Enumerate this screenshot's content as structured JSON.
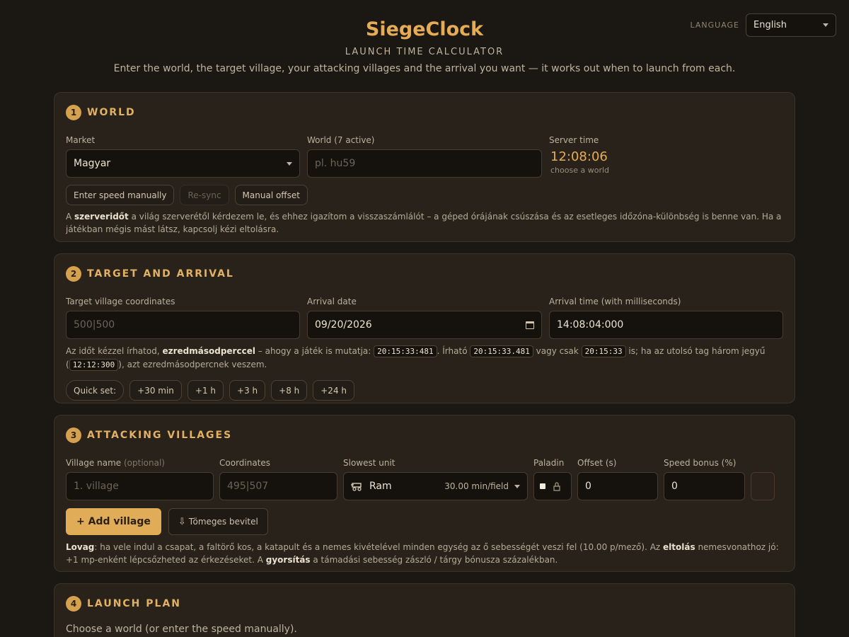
{
  "language": {
    "label": "LANGUAGE",
    "value": "English"
  },
  "header": {
    "title": "SiegeClock",
    "subtitle": "LAUNCH TIME CALCULATOR",
    "intro": "Enter the world, the target village, your attacking villages and the arrival you want — it works out when to launch from each."
  },
  "world": {
    "num": "1",
    "title": "WORLD",
    "market_label": "Market",
    "market_value": "Magyar",
    "world_label": "World (7 active)",
    "world_placeholder": "pl. hu59",
    "server_label": "Server time",
    "server_time": "12:08:06",
    "server_note": "choose a world",
    "btn_speed": "Enter speed manually",
    "btn_resync": "Re-sync",
    "btn_offset": "Manual offset",
    "note_pre": "A ",
    "note_bold": "szerveridőt",
    "note_post": " a világ szerverétől kérdezem le, és ehhez igazítom a visszaszámlálót – a géped órájának csúszása és az esetleges időzóna-különbség is benne van. Ha a játékban mégis mást látsz, kapcsolj kézi eltolásra."
  },
  "target": {
    "num": "2",
    "title": "TARGET AND ARRIVAL",
    "coords_label": "Target village coordinates",
    "coords_placeholder": "500|500",
    "date_label": "Arrival date",
    "date_value": "09/20/2026",
    "time_label": "Arrival time (with milliseconds)",
    "time_value": "14:08:04:000",
    "note_1": "Az időt kézzel írhatod, ",
    "note_bold": "ezredmásodperccel",
    "note_2": " – ahogy a játék is mutatja: ",
    "ex_1": "20:15:33:481",
    "note_3": ". Írható ",
    "ex_2": "20:15:33.481",
    "note_4": " vagy csak ",
    "ex_3": "20:15:33",
    "note_5": " is; ha az utolsó tag három jegyű (",
    "ex_4": "12:12:300",
    "note_6": "), azt ezredmásodpercnek veszem.",
    "quick_label": "Quick set:",
    "quick": [
      "+30 min",
      "+1 h",
      "+3 h",
      "+8 h",
      "+24 h"
    ]
  },
  "attack": {
    "num": "3",
    "title": "ATTACKING VILLAGES",
    "name_label": "Village name",
    "name_optional": "(optional)",
    "name_placeholder": "1. village",
    "coords_label": "Coordinates",
    "coords_placeholder": "495|507",
    "unit_label": "Slowest unit",
    "unit_value": "Ram",
    "unit_speed": "30.00 min/field",
    "paladin_label": "Paladin",
    "offset_label": "Offset (s)",
    "offset_value": "0",
    "bonus_label": "Speed bonus (%)",
    "bonus_value": "0",
    "add_btn": "+ Add village",
    "bulk_btn": "Tömeges bevitel",
    "note_b1": "Lovag",
    "note_1": ": ha vele indul a csapat, a faltörő kos, a katapult és a nemes kivételével minden egység az ő sebességét veszi fel (10.00 p/mező). Az ",
    "note_b2": "eltolás",
    "note_2": " nemesvonathoz jó: +1 mp-enként lépcsőzheted az érkezéseket. A ",
    "note_b3": "gyorsítás",
    "note_3": " a támadási sebesség zászló / tárgy bónusza százalékban."
  },
  "plan": {
    "num": "4",
    "title": "LAUNCH PLAN",
    "message": "Choose a world (or enter the speed manually)."
  },
  "colors": {
    "accent": "#e1ac57",
    "background": "#1b1712",
    "card": "#28221b"
  }
}
